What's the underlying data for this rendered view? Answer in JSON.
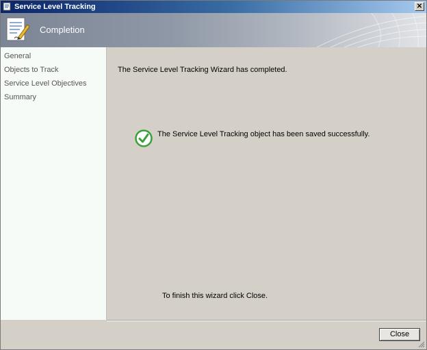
{
  "window": {
    "title": "Service Level Tracking",
    "close_glyph": "✕"
  },
  "header": {
    "title": "Completion",
    "icon": "document-pencil-icon"
  },
  "nav": {
    "items": [
      {
        "label": "General"
      },
      {
        "label": "Objects to Track"
      },
      {
        "label": "Service Level Objectives"
      },
      {
        "label": "Summary"
      }
    ]
  },
  "main": {
    "completed_text": "The Service Level Tracking Wizard has completed.",
    "status_text": "The Service Level Tracking object has been saved successfully.",
    "status_icon": "green-check-icon",
    "finish_text": "To finish this wizard click Close."
  },
  "footer": {
    "close_label": "Close"
  },
  "colors": {
    "title_bar": "#0a246a",
    "check_green": "#3aa13a",
    "nav_bg": "#f7fbf8",
    "content_bg": "#d4d0c8"
  }
}
